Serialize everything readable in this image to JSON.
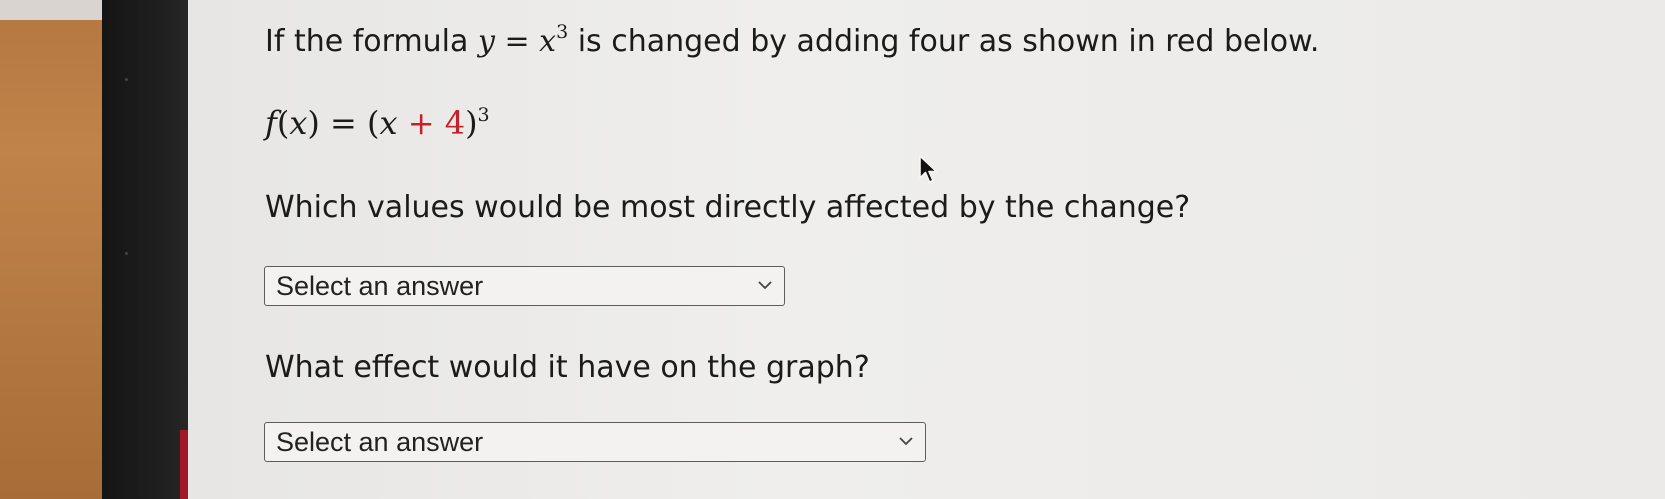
{
  "question": {
    "intro_prefix": "If the formula",
    "intro_lhs": "y",
    "intro_eq": "=",
    "intro_base": "x",
    "intro_exp": "3",
    "intro_suffix": "is changed by adding four as shown in red below."
  },
  "formula": {
    "fname": "f",
    "open_paren": "(",
    "var": "x",
    "close_paren": ")",
    "equals": "=",
    "lparen": "(",
    "base": "x",
    "plus": "+",
    "added": "4",
    "rparen": ")",
    "exponent": "3"
  },
  "question1": {
    "text": "Which values would be most directly affected by the change?"
  },
  "select1": {
    "value": "Select an answer"
  },
  "question2": {
    "text": "What effect would it have on the graph?"
  },
  "select2": {
    "value": "Select an answer"
  },
  "colors": {
    "highlight": "#c8202a",
    "text": "#1b1b1b",
    "background": "#ecebe9"
  },
  "icons": {
    "select_chevron": "chevron-down-icon",
    "pointer": "mouse-cursor-icon"
  }
}
